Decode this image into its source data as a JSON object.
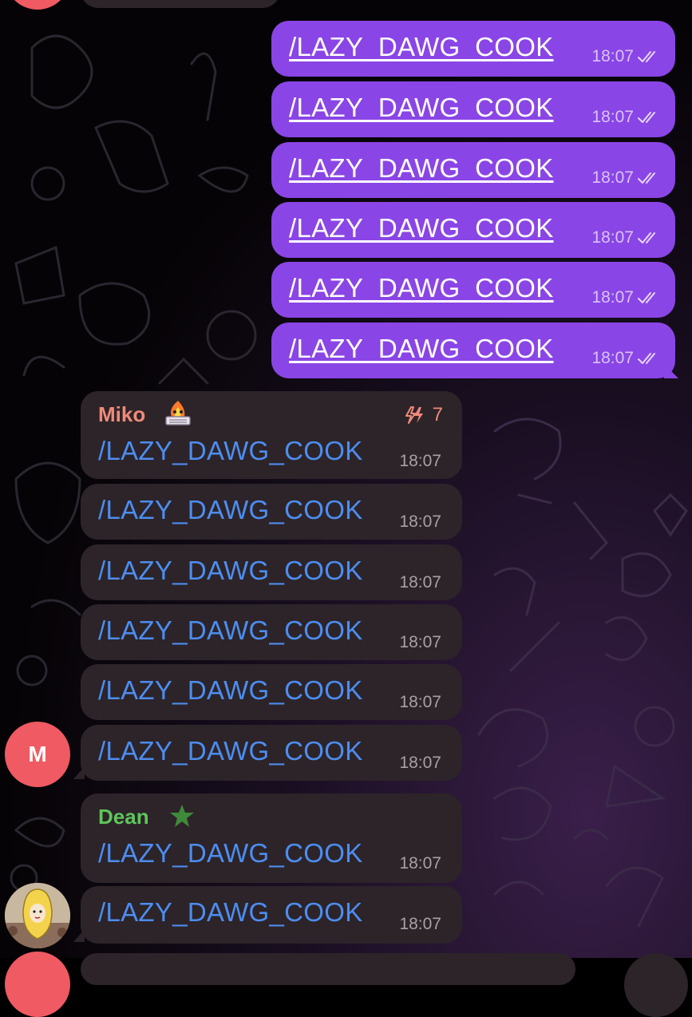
{
  "outgoing": [
    {
      "text": "/LAZY_DAWG_COOK",
      "time": "18:07"
    },
    {
      "text": "/LAZY_DAWG_COOK",
      "time": "18:07"
    },
    {
      "text": "/LAZY_DAWG_COOK",
      "time": "18:07"
    },
    {
      "text": "/LAZY_DAWG_COOK",
      "time": "18:07"
    },
    {
      "text": "/LAZY_DAWG_COOK",
      "time": "18:07"
    },
    {
      "text": "/LAZY_DAWG_COOK",
      "time": "18:07"
    }
  ],
  "miko": {
    "name": "Miko",
    "name_color": "#f08a7a",
    "boost_count": "7",
    "avatar_letter": "M",
    "avatar_color": "#ef5a63",
    "messages": [
      {
        "text": "/LAZY_DAWG_COOK",
        "time": "18:07"
      },
      {
        "text": "/LAZY_DAWG_COOK",
        "time": "18:07"
      },
      {
        "text": "/LAZY_DAWG_COOK",
        "time": "18:07"
      },
      {
        "text": "/LAZY_DAWG_COOK",
        "time": "18:07"
      },
      {
        "text": "/LAZY_DAWG_COOK",
        "time": "18:07"
      },
      {
        "text": "/LAZY_DAWG_COOK",
        "time": "18:07"
      }
    ]
  },
  "dean": {
    "name": "Dean",
    "name_color": "#5ec55a",
    "messages": [
      {
        "text": "/LAZY_DAWG_COOK",
        "time": "18:07"
      },
      {
        "text": "/LAZY_DAWG_COOK",
        "time": "18:07"
      }
    ]
  },
  "colors": {
    "outgoing_bubble": "#8a45e6",
    "incoming_bubble": "#2c2429",
    "link": "#4d8df0"
  },
  "icons": {
    "read_receipt": "double-check-icon",
    "boost": "lightning-boost-icon",
    "miko_emoji": "fire-keyboard-emoji-icon",
    "dean_emoji": "star-icon"
  }
}
